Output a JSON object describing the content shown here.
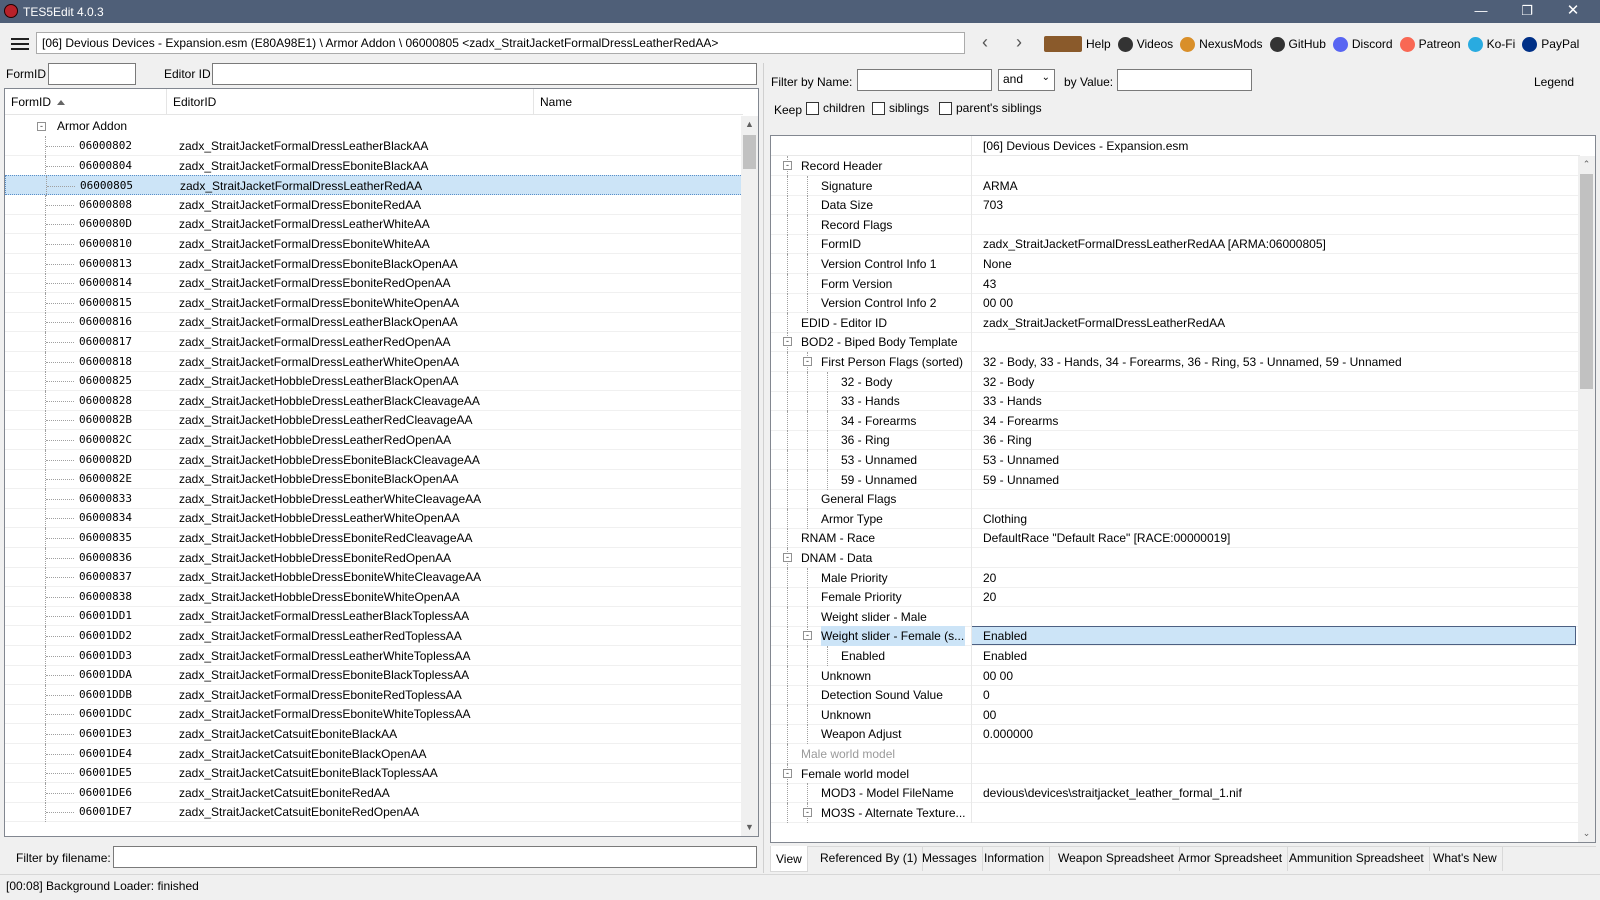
{
  "window": {
    "title": "TES5Edit 4.0.3"
  },
  "toolbar": {
    "path": "[06] Devious Devices - Expansion.esm (E80A98E1) \\ Armor Addon \\ 06000805 <zadx_StraitJacketFormalDressLeatherRedAA>",
    "links": [
      {
        "label": "Help",
        "icon": "book-icon",
        "color": "#8a5a2b"
      },
      {
        "label": "Videos",
        "icon": "videos-icon",
        "color": "#333333"
      },
      {
        "label": "NexusMods",
        "icon": "nexusmods-icon",
        "color": "#d98f29"
      },
      {
        "label": "GitHub",
        "icon": "github-icon",
        "color": "#333333"
      },
      {
        "label": "Discord",
        "icon": "discord-icon",
        "color": "#5865f2"
      },
      {
        "label": "Patreon",
        "icon": "patreon-icon",
        "color": "#f96854"
      },
      {
        "label": "Ko-Fi",
        "icon": "kofi-icon",
        "color": "#29abe0"
      },
      {
        "label": "PayPal",
        "icon": "paypal-icon",
        "color": "#003087"
      }
    ]
  },
  "left": {
    "formid_label": "FormID",
    "editorid_label": "Editor ID",
    "formid_value": "",
    "editorid_value": "",
    "columns": [
      "FormID",
      "EditorID",
      "Name"
    ],
    "group": "Armor Addon",
    "selected_index": 2,
    "records": [
      {
        "formid": "06000802",
        "editorid": "zadx_StraitJacketFormalDressLeatherBlackAA"
      },
      {
        "formid": "06000804",
        "editorid": "zadx_StraitJacketFormalDressEboniteBlackAA"
      },
      {
        "formid": "06000805",
        "editorid": "zadx_StraitJacketFormalDressLeatherRedAA"
      },
      {
        "formid": "06000808",
        "editorid": "zadx_StraitJacketFormalDressEboniteRedAA"
      },
      {
        "formid": "0600080D",
        "editorid": "zadx_StraitJacketFormalDressLeatherWhiteAA"
      },
      {
        "formid": "06000810",
        "editorid": "zadx_StraitJacketFormalDressEboniteWhiteAA"
      },
      {
        "formid": "06000813",
        "editorid": "zadx_StraitJacketFormalDressEboniteBlackOpenAA"
      },
      {
        "formid": "06000814",
        "editorid": "zadx_StraitJacketFormalDressEboniteRedOpenAA"
      },
      {
        "formid": "06000815",
        "editorid": "zadx_StraitJacketFormalDressEboniteWhiteOpenAA"
      },
      {
        "formid": "06000816",
        "editorid": "zadx_StraitJacketFormalDressLeatherBlackOpenAA"
      },
      {
        "formid": "06000817",
        "editorid": "zadx_StraitJacketFormalDressLeatherRedOpenAA"
      },
      {
        "formid": "06000818",
        "editorid": "zadx_StraitJacketFormalDressLeatherWhiteOpenAA"
      },
      {
        "formid": "06000825",
        "editorid": "zadx_StraitJacketHobbleDressLeatherBlackOpenAA"
      },
      {
        "formid": "06000828",
        "editorid": "zadx_StraitJacketHobbleDressLeatherBlackCleavageAA"
      },
      {
        "formid": "0600082B",
        "editorid": "zadx_StraitJacketHobbleDressLeatherRedCleavageAA"
      },
      {
        "formid": "0600082C",
        "editorid": "zadx_StraitJacketHobbleDressLeatherRedOpenAA"
      },
      {
        "formid": "0600082D",
        "editorid": "zadx_StraitJacketHobbleDressEboniteBlackCleavageAA"
      },
      {
        "formid": "0600082E",
        "editorid": "zadx_StraitJacketHobbleDressEboniteBlackOpenAA"
      },
      {
        "formid": "06000833",
        "editorid": "zadx_StraitJacketHobbleDressLeatherWhiteCleavageAA"
      },
      {
        "formid": "06000834",
        "editorid": "zadx_StraitJacketHobbleDressLeatherWhiteOpenAA"
      },
      {
        "formid": "06000835",
        "editorid": "zadx_StraitJacketHobbleDressEboniteRedCleavageAA"
      },
      {
        "formid": "06000836",
        "editorid": "zadx_StraitJacketHobbleDressEboniteRedOpenAA"
      },
      {
        "formid": "06000837",
        "editorid": "zadx_StraitJacketHobbleDressEboniteWhiteCleavageAA"
      },
      {
        "formid": "06000838",
        "editorid": "zadx_StraitJacketHobbleDressEboniteWhiteOpenAA"
      },
      {
        "formid": "06001DD1",
        "editorid": "zadx_StraitJacketFormalDressLeatherBlackToplessAA"
      },
      {
        "formid": "06001DD2",
        "editorid": "zadx_StraitJacketFormalDressLeatherRedToplessAA"
      },
      {
        "formid": "06001DD3",
        "editorid": "zadx_StraitJacketFormalDressLeatherWhiteToplessAA"
      },
      {
        "formid": "06001DDA",
        "editorid": "zadx_StraitJacketFormalDressEboniteBlackToplessAA"
      },
      {
        "formid": "06001DDB",
        "editorid": "zadx_StraitJacketFormalDressEboniteRedToplessAA"
      },
      {
        "formid": "06001DDC",
        "editorid": "zadx_StraitJacketFormalDressEboniteWhiteToplessAA"
      },
      {
        "formid": "06001DE3",
        "editorid": "zadx_StraitJacketCatsuitEboniteBlackAA"
      },
      {
        "formid": "06001DE4",
        "editorid": "zadx_StraitJacketCatsuitEboniteBlackOpenAA"
      },
      {
        "formid": "06001DE5",
        "editorid": "zadx_StraitJacketCatsuitEboniteBlackToplessAA"
      },
      {
        "formid": "06001DE6",
        "editorid": "zadx_StraitJacketCatsuitEboniteRedAA"
      },
      {
        "formid": "06001DE7",
        "editorid": "zadx_StraitJacketCatsuitEboniteRedOpenAA"
      }
    ],
    "filter_filename_label": "Filter by filename:",
    "filter_filename_value": ""
  },
  "right": {
    "filter_name_label": "Filter by Name:",
    "filter_name_value": "",
    "and_select": "and",
    "by_value_label": "by Value:",
    "by_value_value": "",
    "legend": "Legend",
    "keep_label": "Keep",
    "keep_children": "children",
    "keep_siblings": "siblings",
    "keep_parents": "parent's siblings",
    "header_file": "[06] Devious Devices - Expansion.esm",
    "rows": [
      {
        "name": "Record Header",
        "value": "",
        "level": 0,
        "exp": "-"
      },
      {
        "name": "Signature",
        "value": "ARMA",
        "level": 1
      },
      {
        "name": "Data Size",
        "value": "703",
        "level": 1
      },
      {
        "name": "Record Flags",
        "value": "",
        "level": 1
      },
      {
        "name": "FormID",
        "value": "zadx_StraitJacketFormalDressLeatherRedAA [ARMA:06000805]",
        "level": 1
      },
      {
        "name": "Version Control Info 1",
        "value": "None",
        "level": 1
      },
      {
        "name": "Form Version",
        "value": "43",
        "level": 1
      },
      {
        "name": "Version Control Info 2",
        "value": "00 00",
        "level": 1
      },
      {
        "name": "EDID - Editor ID",
        "value": "zadx_StraitJacketFormalDressLeatherRedAA",
        "level": 0
      },
      {
        "name": "BOD2 - Biped Body Template",
        "value": "",
        "level": 0,
        "exp": "-"
      },
      {
        "name": "First Person Flags (sorted)",
        "value": "32 - Body, 33 - Hands, 34 - Forearms, 36 - Ring, 53 - Unnamed, 59 - Unnamed",
        "level": 1,
        "exp": "-"
      },
      {
        "name": "32 - Body",
        "value": "32 - Body",
        "level": 2
      },
      {
        "name": "33 - Hands",
        "value": "33 - Hands",
        "level": 2
      },
      {
        "name": "34 - Forearms",
        "value": "34 - Forearms",
        "level": 2
      },
      {
        "name": "36 - Ring",
        "value": "36 - Ring",
        "level": 2
      },
      {
        "name": "53 - Unnamed",
        "value": "53 - Unnamed",
        "level": 2
      },
      {
        "name": "59 - Unnamed",
        "value": "59 - Unnamed",
        "level": 2
      },
      {
        "name": "General Flags",
        "value": "",
        "level": 1
      },
      {
        "name": "Armor Type",
        "value": "Clothing",
        "level": 1
      },
      {
        "name": "RNAM - Race",
        "value": "DefaultRace \"Default Race\" [RACE:00000019]",
        "level": 0
      },
      {
        "name": "DNAM - Data",
        "value": "",
        "level": 0,
        "exp": "-"
      },
      {
        "name": "Male Priority",
        "value": "20",
        "level": 1
      },
      {
        "name": "Female Priority",
        "value": "20",
        "level": 1
      },
      {
        "name": "Weight slider - Male",
        "value": "",
        "level": 1
      },
      {
        "name": "Weight slider - Female (s...",
        "value": "Enabled",
        "level": 1,
        "exp": "-",
        "sel": true
      },
      {
        "name": "Enabled",
        "value": "Enabled",
        "level": 2
      },
      {
        "name": "Unknown",
        "value": "00 00",
        "level": 1
      },
      {
        "name": "Detection Sound Value",
        "value": "0",
        "level": 1
      },
      {
        "name": "Unknown",
        "value": "00",
        "level": 1
      },
      {
        "name": "Weapon Adjust",
        "value": "0.000000",
        "level": 1
      },
      {
        "name": "Male world model",
        "value": "",
        "level": 0,
        "dim": true
      },
      {
        "name": "Female world model",
        "value": "",
        "level": 0,
        "exp": "-"
      },
      {
        "name": "MOD3 - Model FileName",
        "value": "devious\\devices\\straitjacket_leather_formal_1.nif",
        "level": 1
      },
      {
        "name": "MO3S - Alternate Texture...",
        "value": "",
        "level": 1,
        "exp": "-"
      }
    ],
    "tabs": [
      "View",
      "Referenced By (1)",
      "Messages",
      "Information",
      "Weapon Spreadsheet",
      "Armor Spreadsheet",
      "Ammunition Spreadsheet",
      "What's New"
    ],
    "active_tab": "View"
  },
  "status": {
    "text": "[00:08] Background Loader: finished"
  }
}
